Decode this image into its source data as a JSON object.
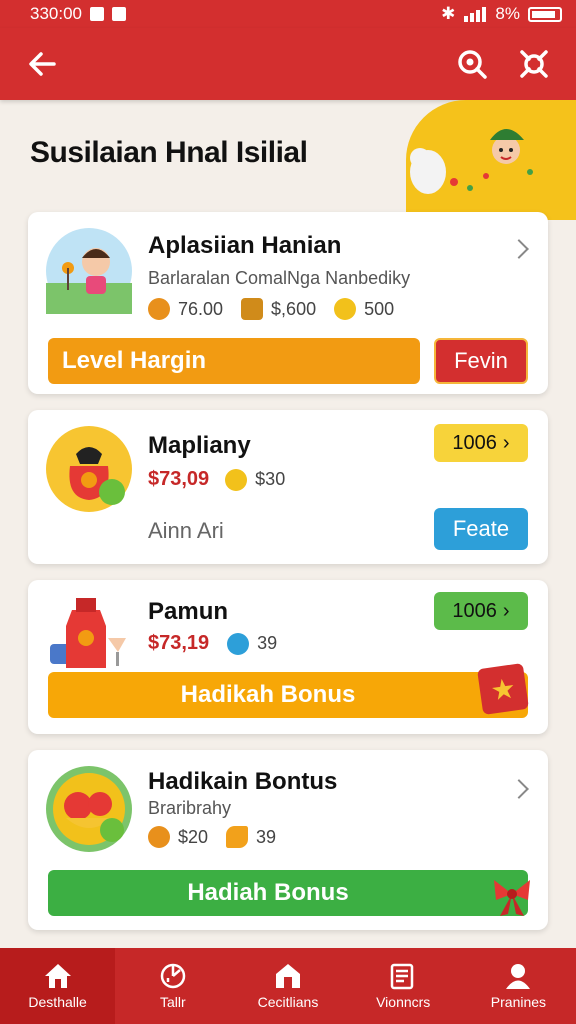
{
  "status": {
    "time": "330:00",
    "battery": "8%"
  },
  "page": {
    "title": "Susilaian Hnal Isilial"
  },
  "cards": [
    {
      "title": "Aplasiian Hanian",
      "subtitle": "Barlaralan ComalNga Nanbediky",
      "stats": [
        "76.00",
        "$,600",
        "500"
      ],
      "bar_label": "Level Hargin",
      "button_label": "Fevin"
    },
    {
      "title": "Mapliany",
      "price": "$73,09",
      "stat": "$30",
      "note": "Ainn Ari",
      "badge": "1006",
      "button_label": "Feate"
    },
    {
      "title": "Pamun",
      "price": "$73,19",
      "stat": "39",
      "badge": "1006",
      "bar_label": "Hadikah Bonus"
    },
    {
      "title": "Hadikain Bontus",
      "subtitle": "Braribrahy",
      "stats": [
        "$20",
        "39"
      ],
      "bar_label": "Hadiah Bonus"
    }
  ],
  "nav": [
    {
      "label": "Desthalle",
      "icon": "home-icon"
    },
    {
      "label": "Tallr",
      "icon": "chart-icon"
    },
    {
      "label": "Cecitlians",
      "icon": "store-icon"
    },
    {
      "label": "Vionncrs",
      "icon": "list-icon"
    },
    {
      "label": "Pranines",
      "icon": "profile-icon"
    }
  ],
  "colors": {
    "primary": "#d32f2f",
    "orange": "#f29b12",
    "amber": "#f7a707",
    "green": "#3caf43",
    "blue": "#2d9fd9",
    "yellow": "#f5c21b"
  }
}
